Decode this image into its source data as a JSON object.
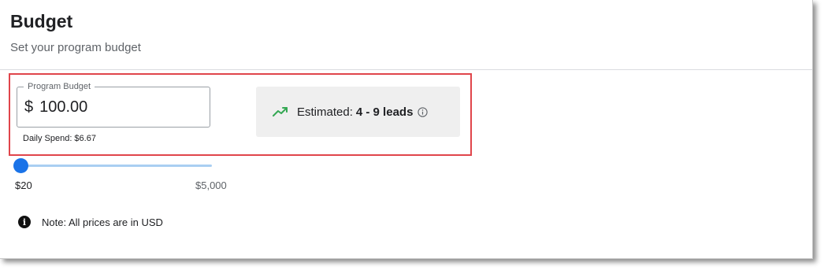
{
  "header": {
    "title": "Budget",
    "subtitle": "Set your program budget"
  },
  "budget": {
    "legend": "Program Budget",
    "currency_symbol": "$",
    "value": "100.00",
    "daily_spend": "Daily Spend: $6.67"
  },
  "estimate": {
    "label": "Estimated:",
    "value": "4 - 9 leads",
    "trend_icon": "trending-up-icon",
    "info_icon": "info-outline-icon"
  },
  "slider": {
    "min_label": "$20",
    "max_label": "$5,000",
    "position": 0.0
  },
  "note": {
    "icon": "info-filled-icon",
    "text": "Note: All prices are in USD"
  },
  "colors": {
    "accent": "#1a73e8",
    "track": "#a9cff2",
    "trend": "#34a853",
    "highlight_border": "#e0454b",
    "estimate_bg": "#efefef"
  }
}
